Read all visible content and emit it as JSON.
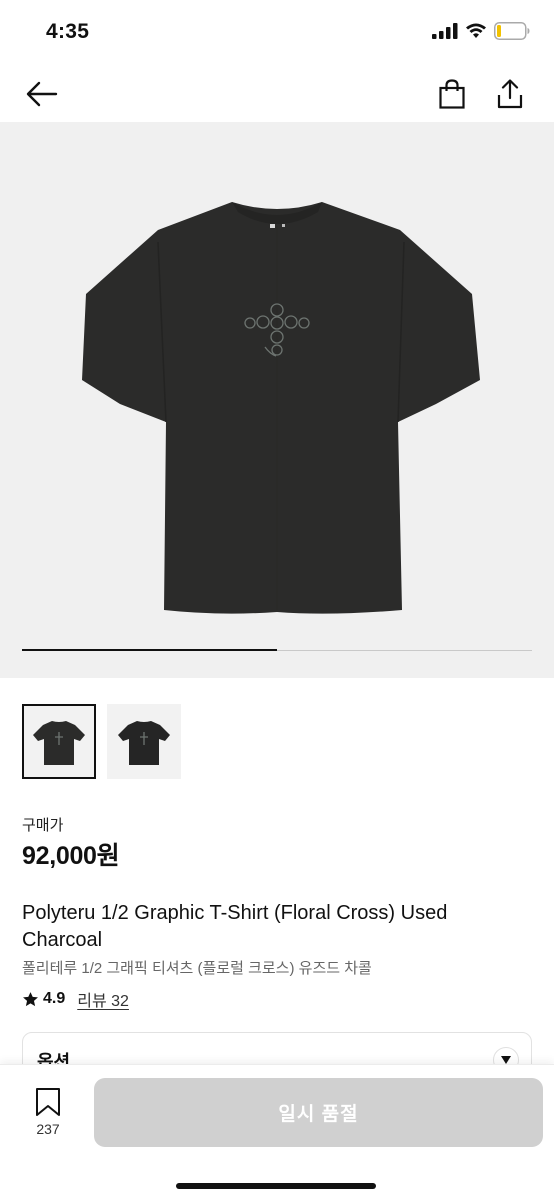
{
  "status_bar": {
    "time": "4:35"
  },
  "product": {
    "price_label": "구매가",
    "price": "92,000원",
    "name": "Polyteru 1/2 Graphic T-Shirt (Floral Cross) Used Charcoal",
    "name_ko": "폴리테루 1/2 그래픽 티셔츠 (플로럴 크로스) 유즈드 차콜",
    "rating": "4.9",
    "review_label": "리뷰 32",
    "gallery_progress": 0.5
  },
  "options": {
    "label": "옵션"
  },
  "bottom_bar": {
    "wishlist_count": "237",
    "soldout_label": "일시 품절"
  },
  "icons": [
    "back-arrow-icon",
    "shopping-bag-icon",
    "share-icon",
    "star-icon",
    "bookmark-icon",
    "chevron-down-icon",
    "signal-icon",
    "wifi-icon",
    "battery-icon"
  ],
  "colors": {
    "garment": "#2b2b2a",
    "image_bg": "#f0f0f0",
    "button_disabled": "#d0d0d0"
  }
}
